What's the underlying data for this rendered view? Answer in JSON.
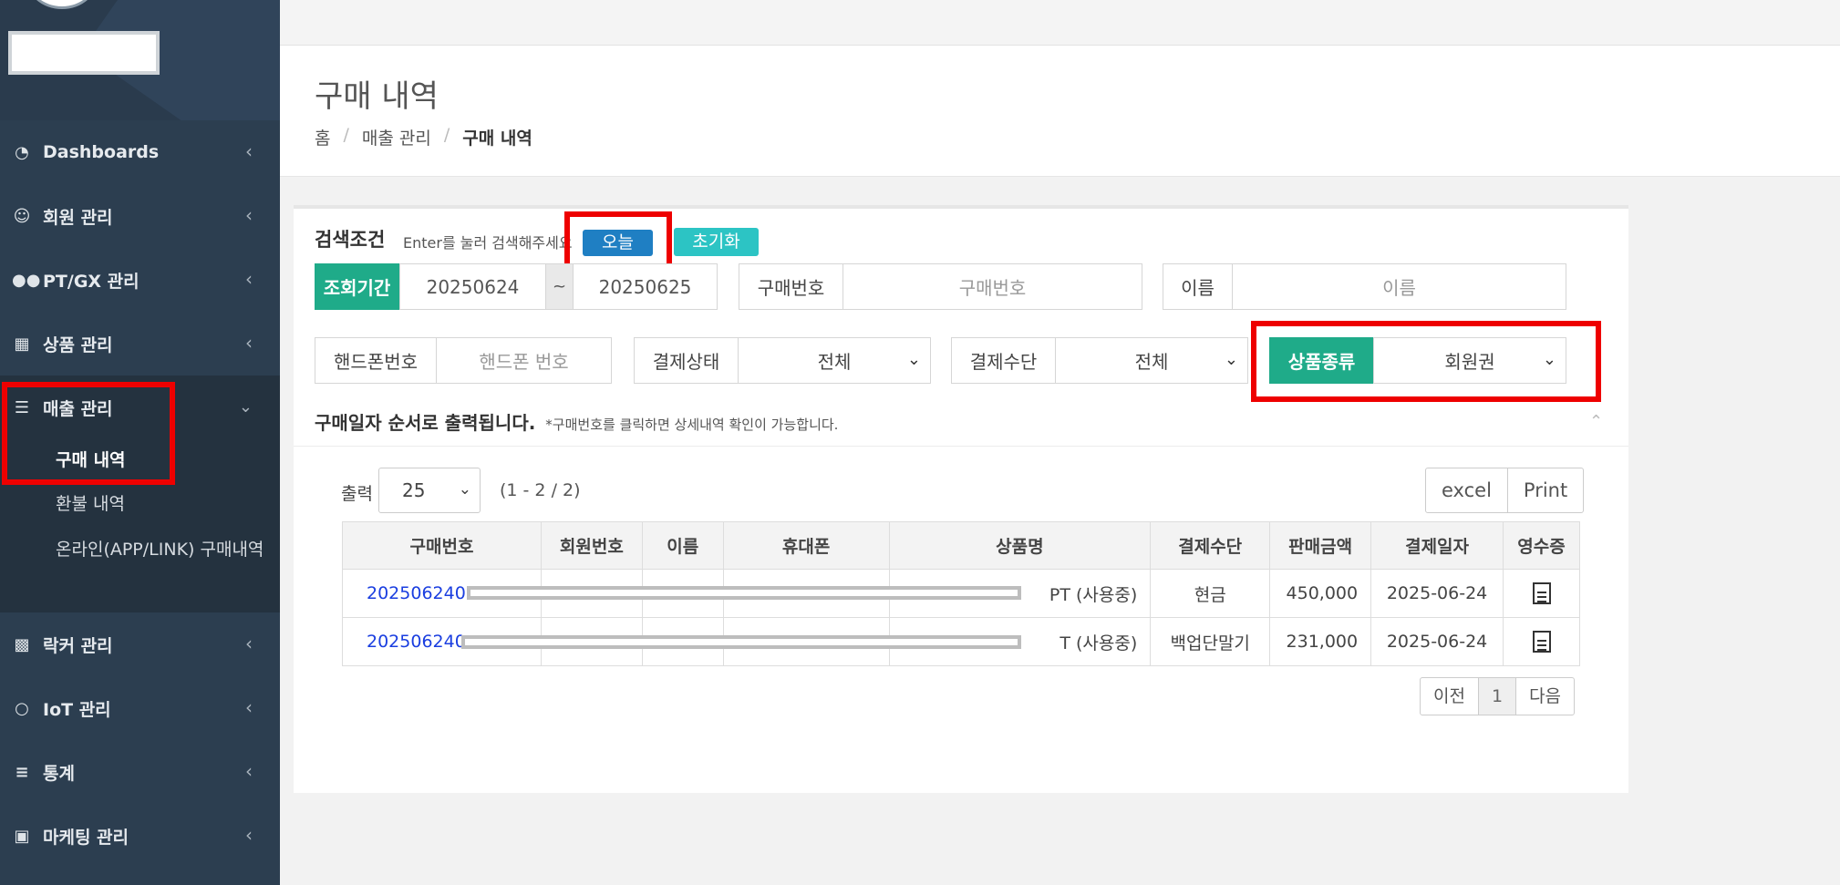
{
  "sidebar": {
    "items": [
      {
        "label": "Dashboards",
        "icon": "dashboard-icon"
      },
      {
        "label": "회원 관리",
        "icon": "smile-icon"
      },
      {
        "label": "PT/GX 관리",
        "icon": "bicycle-icon"
      },
      {
        "label": "상품 관리",
        "icon": "gift-icon"
      },
      {
        "label": "매출 관리",
        "icon": "list-icon"
      },
      {
        "label": "락커 관리",
        "icon": "cubes-icon"
      },
      {
        "label": "IoT 관리",
        "icon": "bulb-icon"
      },
      {
        "label": "통계",
        "icon": "database-icon"
      },
      {
        "label": "마케팅 관리",
        "icon": "image-icon"
      }
    ],
    "sub_items": [
      "구매 내역",
      "환불 내역",
      "온라인(APP/LINK) 구매내역"
    ]
  },
  "header": {
    "title": "구매 내역",
    "breadcrumb": [
      "홈",
      "매출 관리",
      "구매 내역"
    ]
  },
  "search": {
    "label": "검색조건",
    "hint": "Enter를 눌러 검색해주세요",
    "today_button": "오늘",
    "reset_button": "초기화",
    "period_label": "조회기간",
    "date_from": "20250624",
    "tilde": "~",
    "date_to": "20250625",
    "purchase_no_label": "구매번호",
    "purchase_no_placeholder": "구매번호",
    "name_label": "이름",
    "name_placeholder": "이름",
    "phone_label": "핸드폰번호",
    "phone_placeholder": "핸드폰 번호",
    "pay_status_label": "결제상태",
    "pay_status_value": "전체",
    "pay_method_label": "결제수단",
    "pay_method_value": "전체",
    "product_type_label": "상품종류",
    "product_type_value": "회원권"
  },
  "list": {
    "order_note": "구매일자 순서로 출력됩니다.",
    "order_note_small": "*구매번호를 클릭하면 상세내역 확인이 가능합니다.",
    "output_label": "출력",
    "page_size": "25",
    "count_text": "(1 - 2 / 2)",
    "excel_button": "excel",
    "print_button": "Print",
    "columns": [
      "구매번호",
      "회원번호",
      "이름",
      "휴대폰",
      "상품명",
      "결제수단",
      "판매금액",
      "결제일자",
      "영수증"
    ],
    "rows": [
      {
        "purchase_no": "2025062406",
        "product": "PT (사용중)",
        "method": "현금",
        "amount": "450,000",
        "date": "2025-06-24"
      },
      {
        "purchase_no": "202506240",
        "product": "T (사용중)",
        "method": "백업단말기",
        "amount": "231,000",
        "date": "2025-06-24"
      }
    ]
  },
  "pager": {
    "prev": "이전",
    "page": "1",
    "next": "다음"
  }
}
